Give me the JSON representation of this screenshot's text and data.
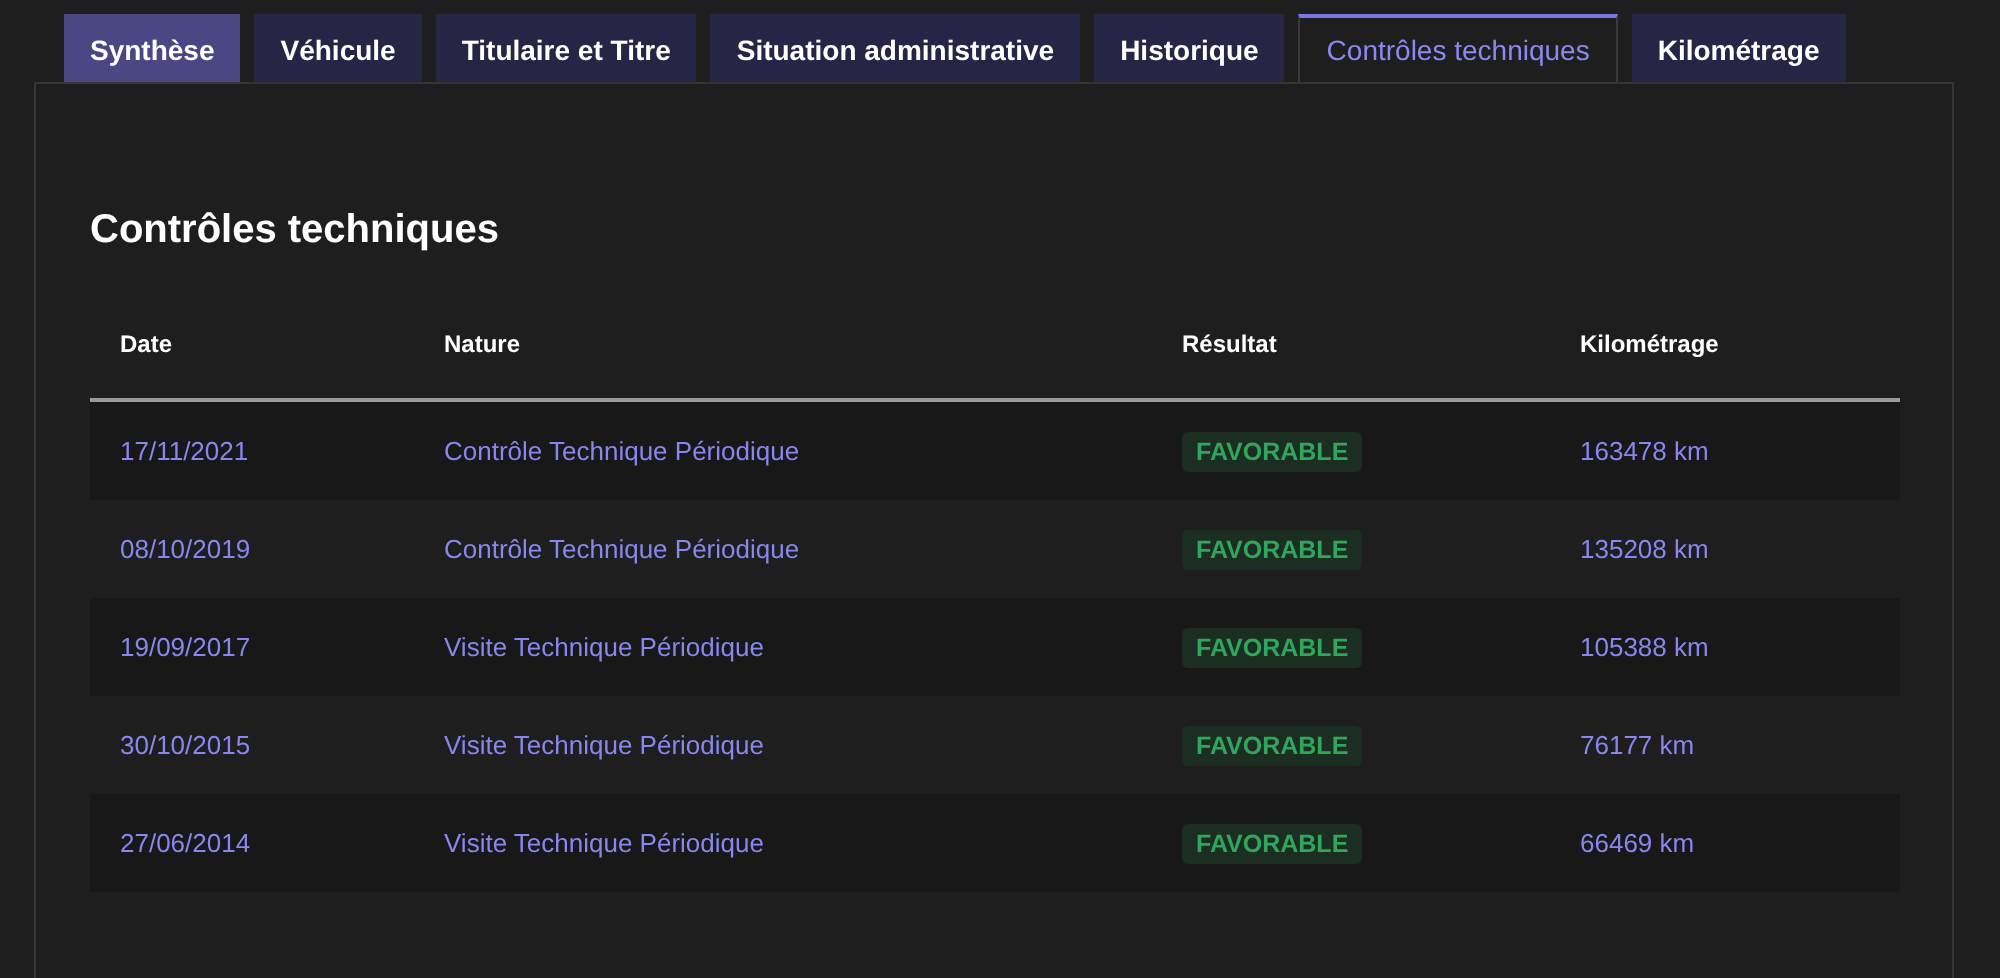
{
  "tabs": [
    {
      "label": "Synthèse",
      "selected": false,
      "highlighted": true
    },
    {
      "label": "Véhicule",
      "selected": false,
      "highlighted": false
    },
    {
      "label": "Titulaire et Titre",
      "selected": false,
      "highlighted": false
    },
    {
      "label": "Situation administrative",
      "selected": false,
      "highlighted": false
    },
    {
      "label": "Historique",
      "selected": false,
      "highlighted": false
    },
    {
      "label": "Contrôles techniques",
      "selected": true,
      "highlighted": false
    },
    {
      "label": "Kilométrage",
      "selected": false,
      "highlighted": false
    }
  ],
  "section_title": "Contrôles techniques",
  "table": {
    "columns": [
      "Date",
      "Nature",
      "Résultat",
      "Kilométrage"
    ],
    "rows": [
      {
        "date": "17/11/2021",
        "nature": "Contrôle Technique Périodique",
        "result": "FAVORABLE",
        "mileage": "163478 km"
      },
      {
        "date": "08/10/2019",
        "nature": "Contrôle Technique Périodique",
        "result": "FAVORABLE",
        "mileage": "135208 km"
      },
      {
        "date": "19/09/2017",
        "nature": "Visite Technique Périodique",
        "result": "FAVORABLE",
        "mileage": "105388 km"
      },
      {
        "date": "30/10/2015",
        "nature": "Visite Technique Périodique",
        "result": "FAVORABLE",
        "mileage": "76177 km"
      },
      {
        "date": "27/06/2014",
        "nature": "Visite Technique Périodique",
        "result": "FAVORABLE",
        "mileage": "66469 km"
      }
    ]
  }
}
